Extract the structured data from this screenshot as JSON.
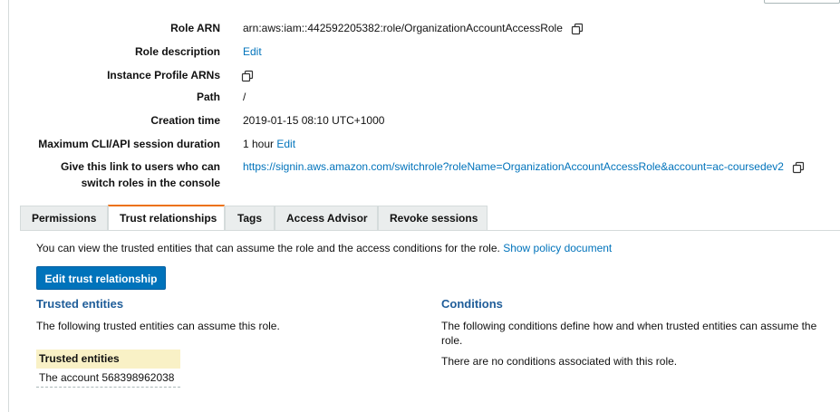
{
  "summary": {
    "rows": [
      {
        "label": "Role ARN",
        "value": "arn:aws:iam::442592205382:role/OrganizationAccountAccessRole",
        "copy": true
      },
      {
        "label": "Role description",
        "link": "Edit"
      },
      {
        "label": "Instance Profile ARNs",
        "copy": true
      },
      {
        "label": "Path",
        "value": "/"
      },
      {
        "label": "Creation time",
        "value": "2019-01-15 08:10 UTC+1000"
      },
      {
        "label": "Maximum CLI/API session duration",
        "value": "1 hour",
        "link": "Edit"
      },
      {
        "label_line1": "Give this link to users who can",
        "label_line2": "switch roles in the console",
        "link": "https://signin.aws.amazon.com/switchrole?roleName=OrganizationAccountAccessRole&account=ac-coursedev2",
        "copy": true
      }
    ]
  },
  "tabs": [
    {
      "label": "Permissions",
      "active": false
    },
    {
      "label": "Trust relationships",
      "active": true
    },
    {
      "label": "Tags",
      "active": false
    },
    {
      "label": "Access Advisor",
      "active": false
    },
    {
      "label": "Revoke sessions",
      "active": false
    }
  ],
  "trust": {
    "intro": "You can view the trusted entities that can assume the role and the access conditions for the role.",
    "show_policy_link": "Show policy document",
    "edit_button": "Edit trust relationship",
    "trusted_entities": {
      "heading": "Trusted entities",
      "description": "The following trusted entities can assume this role.",
      "table_header": "Trusted entities",
      "rows": [
        "The account 568398962038"
      ]
    },
    "conditions": {
      "heading": "Conditions",
      "description": "The following conditions define how and when trusted entities can assume the role.",
      "empty_text": "There are no conditions associated with this role."
    }
  },
  "icons": {
    "copy": "copy-icon"
  },
  "colors": {
    "link": "#0073bb",
    "primary_button": "#0073bb",
    "tab_active_border": "#ec7211",
    "heading": "#1f5d99",
    "table_header_bg": "#f9f1c6"
  }
}
